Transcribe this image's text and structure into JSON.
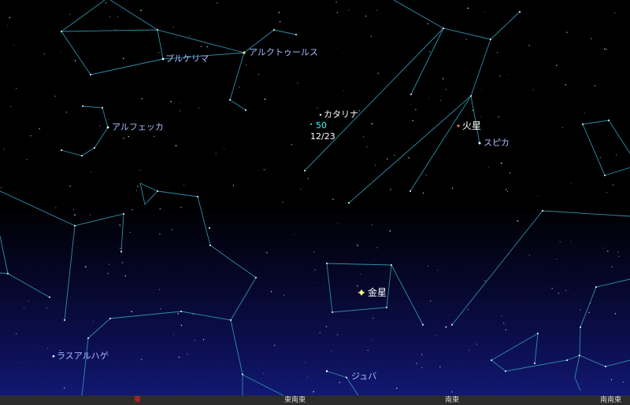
{
  "labels": {
    "arcturus": "アルクトゥールス",
    "pulcherrima": "プルケリマ",
    "alphecca": "アルフェッカ",
    "catalina": "カタリナ",
    "catalina_mag": "50",
    "catalina_date": "12/23",
    "mars": "火星",
    "spica": "スピカ",
    "venus": "金星",
    "rasalhague": "ラスアルハゲ",
    "juba": "ジュバ"
  },
  "directions": {
    "east": "東",
    "east_southeast": "東南東",
    "southeast": "南東",
    "south_southeast": "南南東"
  },
  "colors": {
    "constellation_line": "#2e8fa8",
    "star_label": "#aabbff",
    "comet": "#33ffff",
    "venus": "#ffff88",
    "mars": "#ff7744",
    "east_marker": "#ff2020"
  }
}
